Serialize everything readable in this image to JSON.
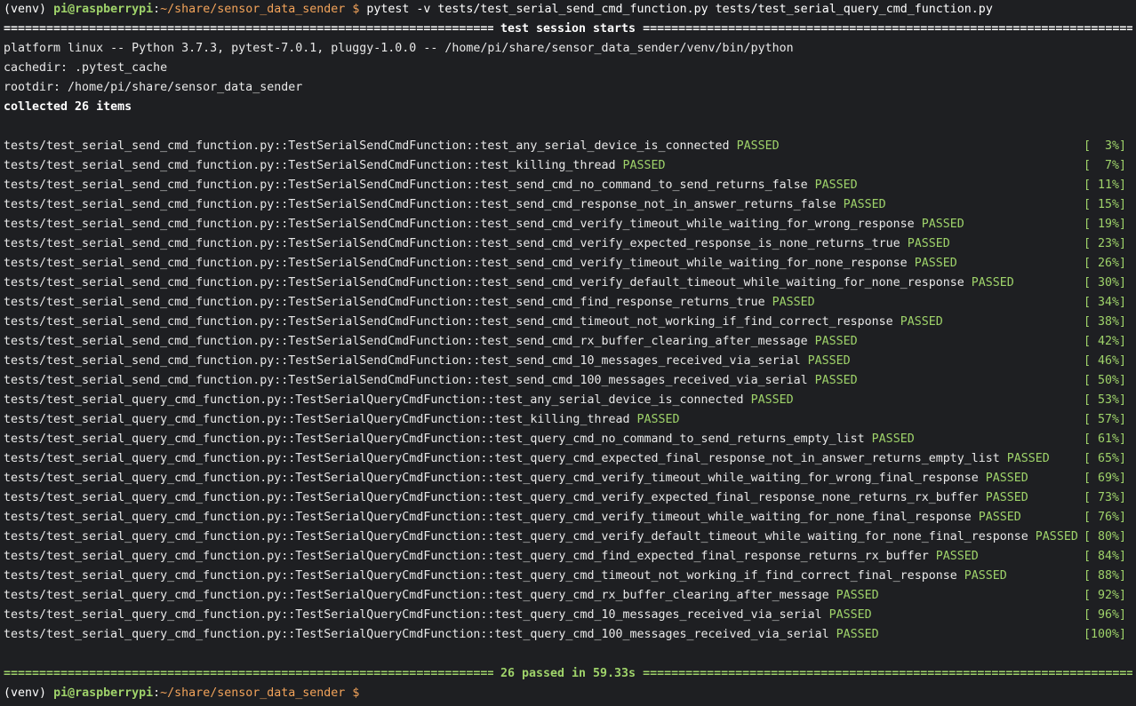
{
  "prompt": {
    "venv": "(venv)",
    "user_host": "pi@raspberrypi",
    "colon": ":",
    "path": "~/share/sensor_data_sender",
    "symbol": "$"
  },
  "command": "pytest -v tests/test_serial_send_cmd_function.py tests/test_serial_query_cmd_function.py",
  "session": {
    "header_text": " test session starts ",
    "platform": "platform linux -- Python 3.7.3, pytest-7.0.1, pluggy-1.0.0 -- /home/pi/share/sensor_data_sender/venv/bin/python",
    "cachedir": "cachedir: .pytest_cache",
    "rootdir": "rootdir: /home/pi/share/sensor_data_sender",
    "collected": "collected 26 items"
  },
  "results": [
    {
      "test": "tests/test_serial_send_cmd_function.py::TestSerialSendCmdFunction::test_any_serial_device_is_connected",
      "status": "PASSED",
      "progress": "[  3%]"
    },
    {
      "test": "tests/test_serial_send_cmd_function.py::TestSerialSendCmdFunction::test_killing_thread",
      "status": "PASSED",
      "progress": "[  7%]"
    },
    {
      "test": "tests/test_serial_send_cmd_function.py::TestSerialSendCmdFunction::test_send_cmd_no_command_to_send_returns_false",
      "status": "PASSED",
      "progress": "[ 11%]"
    },
    {
      "test": "tests/test_serial_send_cmd_function.py::TestSerialSendCmdFunction::test_send_cmd_response_not_in_answer_returns_false",
      "status": "PASSED",
      "progress": "[ 15%]"
    },
    {
      "test": "tests/test_serial_send_cmd_function.py::TestSerialSendCmdFunction::test_send_cmd_verify_timeout_while_waiting_for_wrong_response",
      "status": "PASSED",
      "progress": "[ 19%]"
    },
    {
      "test": "tests/test_serial_send_cmd_function.py::TestSerialSendCmdFunction::test_send_cmd_verify_expected_response_is_none_returns_true",
      "status": "PASSED",
      "progress": "[ 23%]"
    },
    {
      "test": "tests/test_serial_send_cmd_function.py::TestSerialSendCmdFunction::test_send_cmd_verify_timeout_while_waiting_for_none_response",
      "status": "PASSED",
      "progress": "[ 26%]"
    },
    {
      "test": "tests/test_serial_send_cmd_function.py::TestSerialSendCmdFunction::test_send_cmd_verify_default_timeout_while_waiting_for_none_response",
      "status": "PASSED",
      "progress": "[ 30%]"
    },
    {
      "test": "tests/test_serial_send_cmd_function.py::TestSerialSendCmdFunction::test_send_cmd_find_response_returns_true",
      "status": "PASSED",
      "progress": "[ 34%]"
    },
    {
      "test": "tests/test_serial_send_cmd_function.py::TestSerialSendCmdFunction::test_send_cmd_timeout_not_working_if_find_correct_response",
      "status": "PASSED",
      "progress": "[ 38%]"
    },
    {
      "test": "tests/test_serial_send_cmd_function.py::TestSerialSendCmdFunction::test_send_cmd_rx_buffer_clearing_after_message",
      "status": "PASSED",
      "progress": "[ 42%]"
    },
    {
      "test": "tests/test_serial_send_cmd_function.py::TestSerialSendCmdFunction::test_send_cmd_10_messages_received_via_serial",
      "status": "PASSED",
      "progress": "[ 46%]"
    },
    {
      "test": "tests/test_serial_send_cmd_function.py::TestSerialSendCmdFunction::test_send_cmd_100_messages_received_via_serial",
      "status": "PASSED",
      "progress": "[ 50%]"
    },
    {
      "test": "tests/test_serial_query_cmd_function.py::TestSerialQueryCmdFunction::test_any_serial_device_is_connected",
      "status": "PASSED",
      "progress": "[ 53%]"
    },
    {
      "test": "tests/test_serial_query_cmd_function.py::TestSerialQueryCmdFunction::test_killing_thread",
      "status": "PASSED",
      "progress": "[ 57%]"
    },
    {
      "test": "tests/test_serial_query_cmd_function.py::TestSerialQueryCmdFunction::test_query_cmd_no_command_to_send_returns_empty_list",
      "status": "PASSED",
      "progress": "[ 61%]"
    },
    {
      "test": "tests/test_serial_query_cmd_function.py::TestSerialQueryCmdFunction::test_query_cmd_expected_final_response_not_in_answer_returns_empty_list",
      "status": "PASSED",
      "progress": "[ 65%]"
    },
    {
      "test": "tests/test_serial_query_cmd_function.py::TestSerialQueryCmdFunction::test_query_cmd_verify_timeout_while_waiting_for_wrong_final_response",
      "status": "PASSED",
      "progress": "[ 69%]"
    },
    {
      "test": "tests/test_serial_query_cmd_function.py::TestSerialQueryCmdFunction::test_query_cmd_verify_expected_final_response_none_returns_rx_buffer",
      "status": "PASSED",
      "progress": "[ 73%]"
    },
    {
      "test": "tests/test_serial_query_cmd_function.py::TestSerialQueryCmdFunction::test_query_cmd_verify_timeout_while_waiting_for_none_final_response",
      "status": "PASSED",
      "progress": "[ 76%]"
    },
    {
      "test": "tests/test_serial_query_cmd_function.py::TestSerialQueryCmdFunction::test_query_cmd_verify_default_timeout_while_waiting_for_none_final_response",
      "status": "PASSED",
      "progress": "[ 80%]"
    },
    {
      "test": "tests/test_serial_query_cmd_function.py::TestSerialQueryCmdFunction::test_query_cmd_find_expected_final_response_returns_rx_buffer",
      "status": "PASSED",
      "progress": "[ 84%]"
    },
    {
      "test": "tests/test_serial_query_cmd_function.py::TestSerialQueryCmdFunction::test_query_cmd_timeout_not_working_if_find_correct_final_response",
      "status": "PASSED",
      "progress": "[ 88%]"
    },
    {
      "test": "tests/test_serial_query_cmd_function.py::TestSerialQueryCmdFunction::test_query_cmd_rx_buffer_clearing_after_message",
      "status": "PASSED",
      "progress": "[ 92%]"
    },
    {
      "test": "tests/test_serial_query_cmd_function.py::TestSerialQueryCmdFunction::test_query_cmd_10_messages_received_via_serial",
      "status": "PASSED",
      "progress": "[ 96%]"
    },
    {
      "test": "tests/test_serial_query_cmd_function.py::TestSerialQueryCmdFunction::test_query_cmd_100_messages_received_via_serial",
      "status": "PASSED",
      "progress": "[100%]"
    }
  ],
  "summary": {
    "text": " 26 passed in 59.33s "
  },
  "colors": {
    "background": "#1e1f22",
    "foreground": "#e8e8e8",
    "passed_green": "#9fd36a",
    "path_orange": "#f2a35a"
  }
}
